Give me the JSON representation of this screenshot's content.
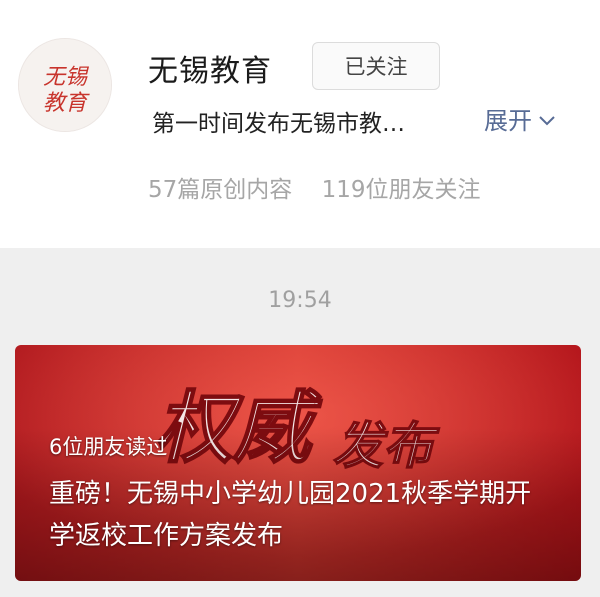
{
  "account": {
    "name": "无锡教育",
    "follow_label": "已关注",
    "description": "第一时间发布无锡市教…",
    "expand_label": "展开",
    "original_count": "57篇原创内容",
    "friends_follow": "119位朋友关注",
    "avatar_text": "无锡教育"
  },
  "feed": {
    "timestamp": "19:54"
  },
  "article": {
    "banner_text_main": "权威",
    "banner_text_sub": "发布",
    "friends_read": "6位朋友读过",
    "title": "重磅！无锡中小学幼儿园2021秋季学期开学返校工作方案发布"
  },
  "colors": {
    "accent_blue": "#576b95",
    "banner_red": "#c82a2a"
  }
}
